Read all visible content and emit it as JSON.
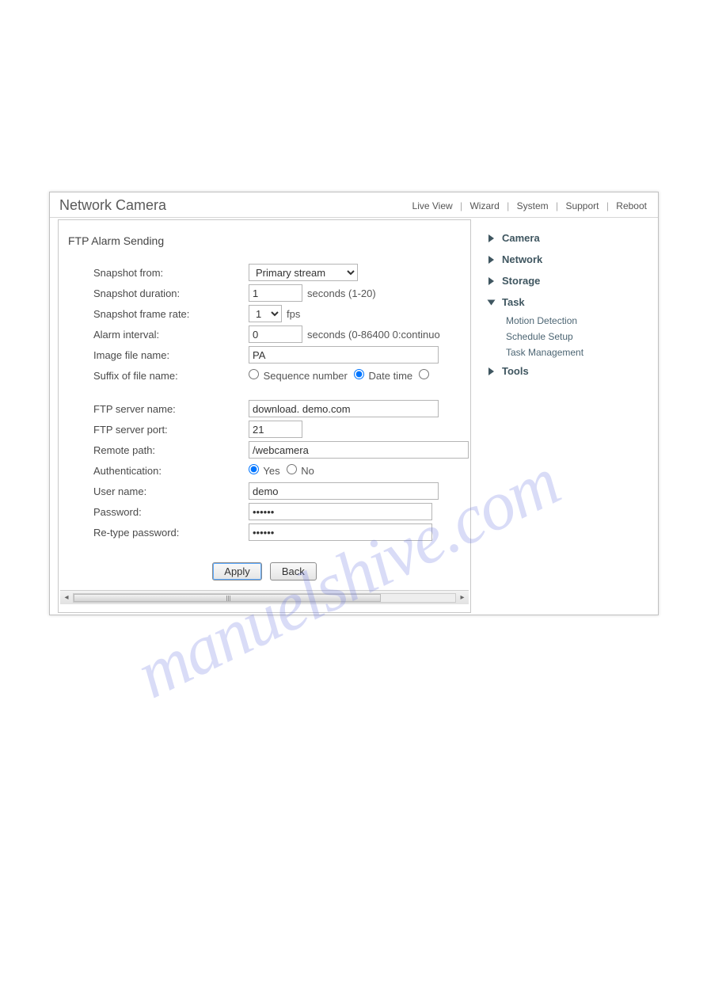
{
  "app_title": "Network Camera",
  "nav": {
    "live_view": "Live View",
    "wizard": "Wizard",
    "system": "System",
    "support": "Support",
    "reboot": "Reboot"
  },
  "page_heading": "FTP Alarm Sending",
  "labels": {
    "snapshot_from": "Snapshot from:",
    "snapshot_duration": "Snapshot duration:",
    "snapshot_frame_rate": "Snapshot frame rate:",
    "alarm_interval": "Alarm interval:",
    "image_file_name": "Image file name:",
    "suffix": "Suffix of file name:",
    "ftp_server_name": "FTP server name:",
    "ftp_server_port": "FTP server port:",
    "remote_path": "Remote path:",
    "authentication": "Authentication:",
    "user_name": "User name:",
    "password": "Password:",
    "retype_password": "Re-type password:"
  },
  "values": {
    "snapshot_from": "Primary stream",
    "snapshot_duration": "1",
    "snapshot_frame_rate": "1",
    "alarm_interval": "0",
    "image_file_name": "PA",
    "ftp_server_name": "download. demo.com",
    "ftp_server_port": "21",
    "remote_path": "/webcamera",
    "user_name": "demo",
    "password": "••••••",
    "retype_password": "••••••"
  },
  "units": {
    "seconds_range": "seconds (1-20)",
    "fps": "fps",
    "seconds_cont": "seconds (0-86400 0:continuo"
  },
  "suffix_options": {
    "sequence_number": "Sequence number",
    "date_time": "Date time"
  },
  "auth_options": {
    "yes": "Yes",
    "no": "No"
  },
  "buttons": {
    "apply": "Apply",
    "back": "Back"
  },
  "sidebar": {
    "camera": "Camera",
    "network": "Network",
    "storage": "Storage",
    "task": "Task",
    "task_sub": {
      "motion_detection": "Motion Detection",
      "schedule_setup": "Schedule Setup",
      "task_management": "Task Management"
    },
    "tools": "Tools"
  },
  "watermark": "manuelshive.com"
}
